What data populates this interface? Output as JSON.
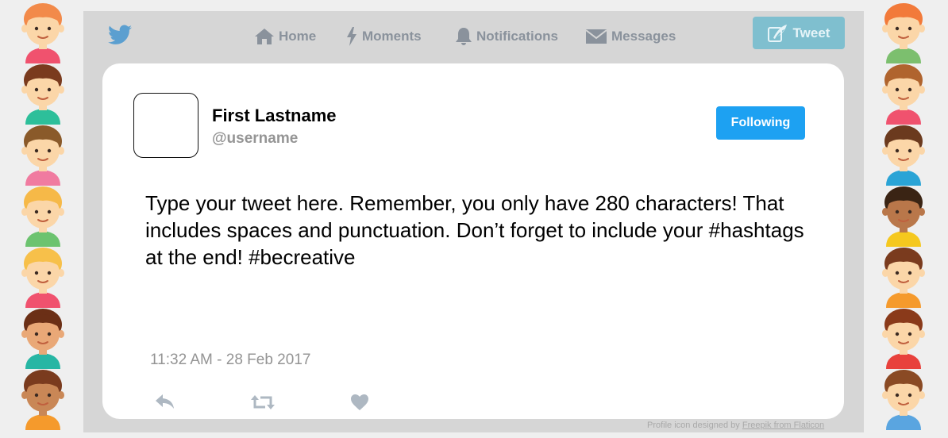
{
  "nav": {
    "home": "Home",
    "moments": "Moments",
    "notifications": "Notifications",
    "messages": "Messages",
    "tweet_button": "Tweet"
  },
  "tweet": {
    "display_name": "First Lastname",
    "username": "@username",
    "follow_button": "Following",
    "text": "Type your tweet here.  Remember, you only have 280 characters! That includes spaces and punctuation. Don’t forget to include your #hashtags at the end! #becreative",
    "timestamp": "11:32 AM - 28 Feb 2017"
  },
  "credit": {
    "prefix": "Profile icon designed by ",
    "link": "Freepik from Flaticon"
  },
  "icons": {
    "logo": "twitter-bird-icon",
    "home": "house-icon",
    "moments": "lightning-icon",
    "notifications": "bell-icon",
    "messages": "envelope-icon",
    "compose": "quill-icon",
    "reply": "reply-arrow-icon",
    "retweet": "retweet-icon",
    "like": "heart-icon"
  },
  "colors": {
    "page_background": "#efefef",
    "frame": "#d6d6d6",
    "follow_button": "#1da1f2",
    "tweet_button": "#7fbfcf",
    "nav_text": "#8a929c",
    "muted_text": "#959595"
  },
  "avatars": {
    "left": [
      {
        "hair": "#f28a4a",
        "skin": "#fbd6a8",
        "shirt": "#f0526e"
      },
      {
        "hair": "#7a3b1e",
        "skin": "#fbd6a8",
        "shirt": "#2dbf9a"
      },
      {
        "hair": "#8a5a2a",
        "skin": "#fbd6a8",
        "shirt": "#f07ba0"
      },
      {
        "hair": "#f6b948",
        "skin": "#fbd6a8",
        "shirt": "#6cc36f"
      },
      {
        "hair": "#f7c04a",
        "skin": "#fbd6a8",
        "shirt": "#f0526e"
      },
      {
        "hair": "#6b2f16",
        "skin": "#e9a877",
        "shirt": "#27b6a4"
      },
      {
        "hair": "#7a3b1e",
        "skin": "#c98756",
        "shirt": "#f59a2c"
      }
    ],
    "right": [
      {
        "hair": "#f27a3a",
        "skin": "#fbd6a8",
        "shirt": "#7cbf6e"
      },
      {
        "hair": "#b0642e",
        "skin": "#fbd6a8",
        "shirt": "#f0526e"
      },
      {
        "hair": "#6b3a1e",
        "skin": "#fbd6a8",
        "shirt": "#2aa4d6"
      },
      {
        "hair": "#3a2414",
        "skin": "#b9774a",
        "shirt": "#f5c81e"
      },
      {
        "hair": "#7a3b1e",
        "skin": "#fbd6a8",
        "shirt": "#f59a2c"
      },
      {
        "hair": "#8a3a1a",
        "skin": "#fbd6a8",
        "shirt": "#e8413c"
      },
      {
        "hair": "#8a4a24",
        "skin": "#fbd6a8",
        "shirt": "#5aa5e0"
      }
    ]
  }
}
